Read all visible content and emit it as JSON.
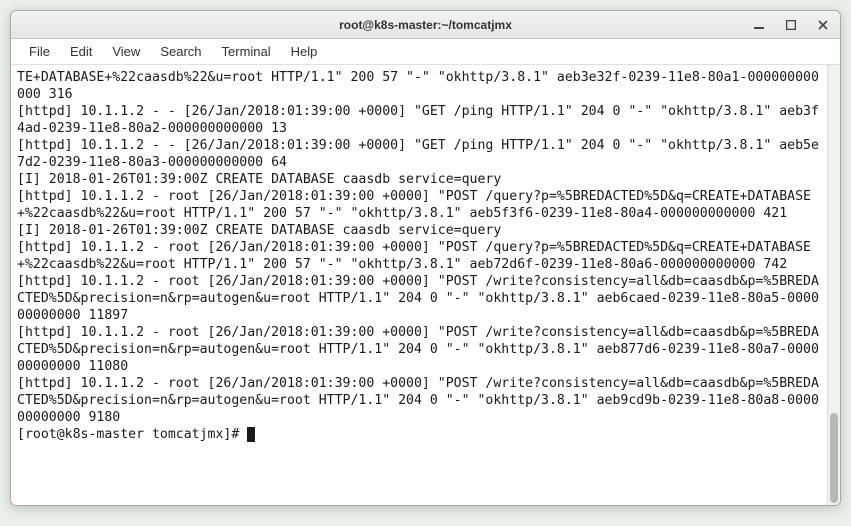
{
  "window": {
    "title": "root@k8s-master:~/tomcatjmx"
  },
  "menubar": {
    "items": [
      "File",
      "Edit",
      "View",
      "Search",
      "Terminal",
      "Help"
    ]
  },
  "terminal": {
    "lines": [
      "TE+DATABASE+%22caasdb%22&u=root HTTP/1.1\" 200 57 \"-\" \"okhttp/3.8.1\" aeb3e32f-0239-11e8-80a1-000000000000 316",
      "[httpd] 10.1.1.2 - - [26/Jan/2018:01:39:00 +0000] \"GET /ping HTTP/1.1\" 204 0 \"-\" \"okhttp/3.8.1\" aeb3f4ad-0239-11e8-80a2-000000000000 13",
      "[httpd] 10.1.1.2 - - [26/Jan/2018:01:39:00 +0000] \"GET /ping HTTP/1.1\" 204 0 \"-\" \"okhttp/3.8.1\" aeb5e7d2-0239-11e8-80a3-000000000000 64",
      "[I] 2018-01-26T01:39:00Z CREATE DATABASE caasdb service=query",
      "[httpd] 10.1.1.2 - root [26/Jan/2018:01:39:00 +0000] \"POST /query?p=%5BREDACTED%5D&q=CREATE+DATABASE+%22caasdb%22&u=root HTTP/1.1\" 200 57 \"-\" \"okhttp/3.8.1\" aeb5f3f6-0239-11e8-80a4-000000000000 421",
      "[I] 2018-01-26T01:39:00Z CREATE DATABASE caasdb service=query",
      "[httpd] 10.1.1.2 - root [26/Jan/2018:01:39:00 +0000] \"POST /query?p=%5BREDACTED%5D&q=CREATE+DATABASE+%22caasdb%22&u=root HTTP/1.1\" 200 57 \"-\" \"okhttp/3.8.1\" aeb72d6f-0239-11e8-80a6-000000000000 742",
      "[httpd] 10.1.1.2 - root [26/Jan/2018:01:39:00 +0000] \"POST /write?consistency=all&db=caasdb&p=%5BREDACTED%5D&precision=n&rp=autogen&u=root HTTP/1.1\" 204 0 \"-\" \"okhttp/3.8.1\" aeb6caed-0239-11e8-80a5-000000000000 11897",
      "[httpd] 10.1.1.2 - root [26/Jan/2018:01:39:00 +0000] \"POST /write?consistency=all&db=caasdb&p=%5BREDACTED%5D&precision=n&rp=autogen&u=root HTTP/1.1\" 204 0 \"-\" \"okhttp/3.8.1\" aeb877d6-0239-11e8-80a7-000000000000 11080",
      "[httpd] 10.1.1.2 - root [26/Jan/2018:01:39:00 +0000] \"POST /write?consistency=all&db=caasdb&p=%5BREDACTED%5D&precision=n&rp=autogen&u=root HTTP/1.1\" 204 0 \"-\" \"okhttp/3.8.1\" aeb9cd9b-0239-11e8-80a8-000000000000 9180"
    ],
    "prompt": "[root@k8s-master tomcatjmx]# "
  }
}
